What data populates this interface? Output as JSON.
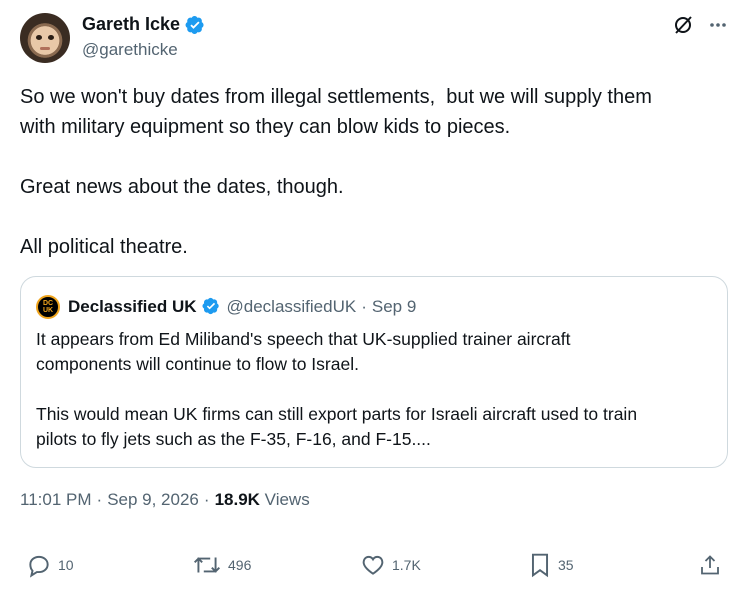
{
  "author": {
    "display_name": "Gareth Icke",
    "handle": "@garethicke",
    "verified": true
  },
  "tweet": {
    "lines": [
      "So we won't buy dates from illegal settlements,  but we will supply them",
      "with military equipment so they can blow kids to pieces.",
      "Great news about the dates, though.",
      "All political theatre."
    ]
  },
  "quoted": {
    "logo_text": "DC\nUK",
    "display_name": "Declassified UK",
    "handle": "@declassifiedUK",
    "separator": "·",
    "date": "Sep 9",
    "lines": [
      "It appears from Ed Miliband's speech that UK-supplied trainer aircraft",
      "components will continue to flow to Israel.",
      "This would mean UK firms can still export parts for Israeli aircraft used to train",
      "pilots to fly jets such as the F-35, F-16, and F-15...."
    ]
  },
  "meta": {
    "time": "11:01 PM",
    "sep1": "·",
    "date": "Sep 9, 2026",
    "sep2": "·",
    "views_count": "18.9K",
    "views_label": "Views"
  },
  "actions": {
    "replies": "10",
    "reposts": "496",
    "likes": "1.7K",
    "bookmarks": "35"
  },
  "colors": {
    "verified": "#1d9bf0",
    "secondary_text": "#536471",
    "border": "#cfd9de"
  },
  "icons": [
    "grok-icon",
    "more-icon",
    "verified-badge-icon",
    "reply-icon",
    "repost-icon",
    "like-icon",
    "bookmark-icon",
    "share-icon"
  ]
}
